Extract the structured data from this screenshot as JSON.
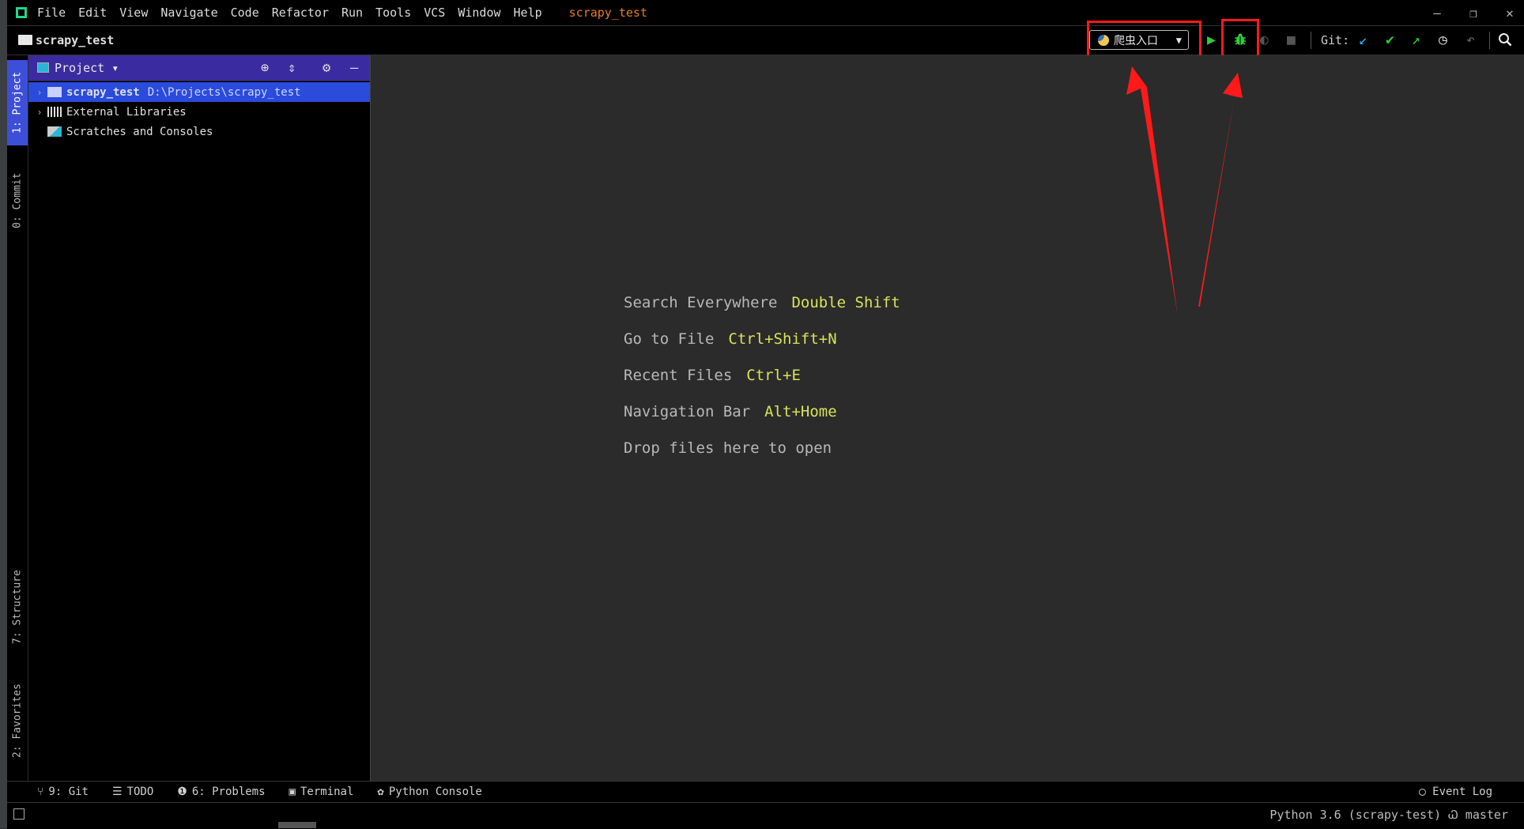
{
  "menu": {
    "items": [
      "File",
      "Edit",
      "View",
      "Navigate",
      "Code",
      "Refactor",
      "Run",
      "Tools",
      "VCS",
      "Window",
      "Help"
    ],
    "project_title": "scrapy_test",
    "window_controls": [
      "—",
      "❐",
      "✕"
    ]
  },
  "navbar": {
    "project": "scrapy_test",
    "run_config": "爬虫入口",
    "git_label": "Git:"
  },
  "left_tabs": {
    "project": "1: Project",
    "commit": "0: Commit",
    "structure": "7: Structure",
    "favorites": "2: Favorites"
  },
  "project_panel": {
    "title": "Project",
    "tree": [
      {
        "label": "scrapy_test",
        "path": "D:\\Projects\\scrapy_test"
      },
      {
        "label": "External Libraries"
      },
      {
        "label": "Scratches and Consoles"
      }
    ]
  },
  "editor": {
    "hints": [
      {
        "text": "Search Everywhere",
        "key": "Double Shift"
      },
      {
        "text": "Go to File",
        "key": "Ctrl+Shift+N"
      },
      {
        "text": "Recent Files",
        "key": "Ctrl+E"
      },
      {
        "text": "Navigation Bar",
        "key": "Alt+Home"
      },
      {
        "text": "Drop files here to open",
        "key": ""
      }
    ]
  },
  "bottom_tools": {
    "git": "9: Git",
    "todo": "TODO",
    "problems": "6: Problems",
    "terminal": "Terminal",
    "python_console": "Python Console",
    "event_log": "Event Log"
  },
  "status": {
    "right_text": "Python 3.6 (scrapy-test)  Ꮗ master"
  },
  "colors": {
    "highlight_red": "#ff1a1a",
    "selection_blue": "#2a4bdb",
    "hint_key": "#d9e35a",
    "run_green": "#2fcf3a",
    "title_orange": "#e67e22"
  }
}
